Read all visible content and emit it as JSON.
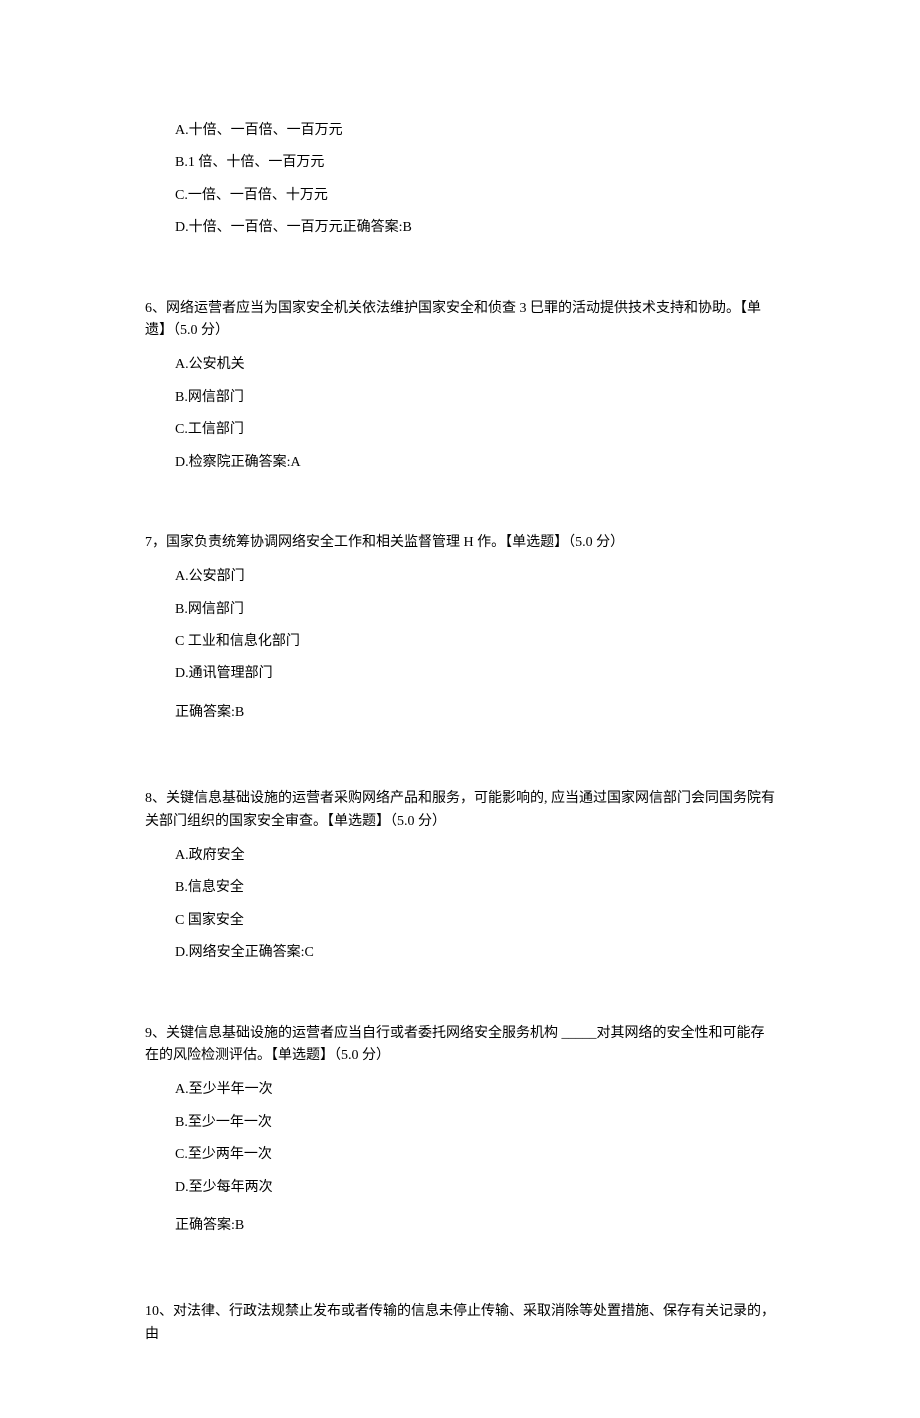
{
  "q5_options": {
    "a": "A.十倍、一百倍、一百万元",
    "b": "B.1 倍、十倍、一百万元",
    "c": "C.一倍、一百倍、十万元",
    "d": "D.十倍、一百倍、一百万元正确答案:B"
  },
  "q6": {
    "stem": "6、网络运营者应当为国家安全机关依法维护国家安全和侦查 3 巳罪的活动提供技术支持和协助。【单遗】（5.0 分）",
    "a": "A.公安机关",
    "b": "B.网信部门",
    "c": "C.工信部门",
    "d": "D.检察院正确答案:A"
  },
  "q7": {
    "stem": "7，国家负责统筹协调网络安全工作和相关监督管理 H 作。【单选题】（5.0 分）",
    "a": "A.公安部门",
    "b": "B.网信部门",
    "c": "C 工业和信息化部门",
    "d": "D.通讯管理部门",
    "answer": "正确答案:B"
  },
  "q8": {
    "stem": "8、关键信息基础设施的运营者采购网络产品和服务，可能影响的, 应当通过国家网信部门会同国务院有关部门组织的国家安全审查。【单选题】（5.0 分）",
    "a": "A.政府安全",
    "b": "B.信息安全",
    "c": "C 国家安全",
    "d": "D.网络安全正确答案:C"
  },
  "q9": {
    "stem": "9、关键信息基础设施的运营者应当自行或者委托网络安全服务机构 _____对其网络的安全性和可能存在的风险检测评估。【单选题】（5.0 分）",
    "a": "A.至少半年一次",
    "b": "B.至少一年一次",
    "c": "C.至少两年一次",
    "d": "D.至少每年两次",
    "answer": "正确答案:B"
  },
  "q10": {
    "stem": "10、对法律、行政法规禁止发布或者传输的信息未停止传输、采取消除等处置措施、保存有关记录的，由"
  }
}
